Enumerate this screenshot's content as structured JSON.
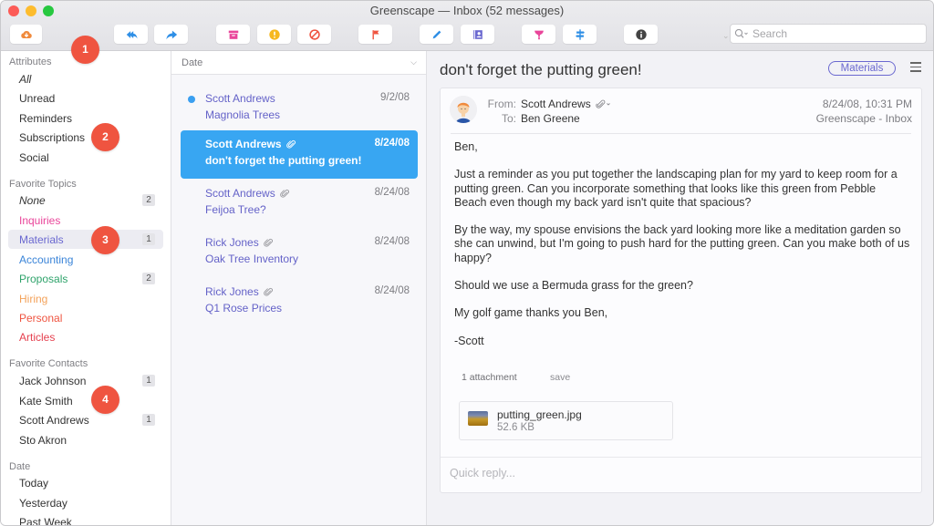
{
  "window": {
    "title": "Greenscape — Inbox (52 messages)"
  },
  "toolbar": {
    "buttons": [
      {
        "name": "get-mail",
        "icon": "cloud-download-icon",
        "color": "#f08a3c"
      },
      {
        "name": "reply-all",
        "icon": "reply-all-icon",
        "color": "#2f8fe6"
      },
      {
        "name": "forward",
        "icon": "forward-icon",
        "color": "#2f8fe6"
      },
      {
        "name": "archive",
        "icon": "archive-box-icon",
        "color": "#e9459a"
      },
      {
        "name": "important",
        "icon": "exclamation-icon",
        "color": "#f6b820"
      },
      {
        "name": "spam",
        "icon": "block-icon",
        "color": "#ef5440"
      },
      {
        "name": "flag",
        "icon": "flag-icon",
        "color": "#ef5440"
      },
      {
        "name": "compose",
        "icon": "pencil-icon",
        "color": "#2f8fe6"
      },
      {
        "name": "contacts",
        "icon": "address-book-icon",
        "color": "#6a68d0"
      },
      {
        "name": "filter",
        "icon": "funnel-icon",
        "color": "#e9459a"
      },
      {
        "name": "rules",
        "icon": "signpost-icon",
        "color": "#2f8fe6"
      },
      {
        "name": "info",
        "icon": "info-icon",
        "color": "#444444"
      }
    ],
    "search_placeholder": "Search"
  },
  "sidebar": {
    "attributes": {
      "heading": "Attributes",
      "items": [
        {
          "label": "All",
          "italic": true
        },
        {
          "label": "Unread"
        },
        {
          "label": "Reminders"
        },
        {
          "label": "Subscriptions"
        },
        {
          "label": "Social"
        }
      ]
    },
    "topics": {
      "heading": "Favorite Topics",
      "items": [
        {
          "label": "None",
          "italic": true,
          "count": "2",
          "color": "#333333"
        },
        {
          "label": "Inquiries",
          "color": "#e9459a"
        },
        {
          "label": "Materials",
          "count": "1",
          "color": "#6a68d0",
          "active": true
        },
        {
          "label": "Accounting",
          "color": "#3a84d8"
        },
        {
          "label": "Proposals",
          "count": "2",
          "color": "#2fa36b"
        },
        {
          "label": "Hiring",
          "color": "#f3a25a"
        },
        {
          "label": "Personal",
          "color": "#ef5440"
        },
        {
          "label": "Articles",
          "color": "#e5404f"
        }
      ]
    },
    "contacts": {
      "heading": "Favorite Contacts",
      "items": [
        {
          "label": "Jack Johnson",
          "count": "1"
        },
        {
          "label": "Kate Smith"
        },
        {
          "label": "Scott Andrews",
          "count": "1"
        },
        {
          "label": "Sto Akron"
        }
      ]
    },
    "date": {
      "heading": "Date",
      "items": [
        {
          "label": "Today"
        },
        {
          "label": "Yesterday"
        },
        {
          "label": "Past Week"
        }
      ]
    }
  },
  "message_list": {
    "sort_label": "Date",
    "messages": [
      {
        "from": "Scott Andrews",
        "subject": "Magnolia Trees",
        "date": "9/2/08",
        "unread": true,
        "attachment": false
      },
      {
        "from": "Scott Andrews",
        "subject": "don't forget the putting green!",
        "date": "8/24/08",
        "selected": true,
        "attachment": true
      },
      {
        "from": "Scott Andrews",
        "subject": "Feijoa Tree?",
        "date": "8/24/08",
        "attachment": true
      },
      {
        "from": "Rick Jones",
        "subject": "Oak Tree Inventory",
        "date": "8/24/08",
        "attachment": true
      },
      {
        "from": "Rick Jones",
        "subject": "Q1 Rose Prices",
        "date": "8/24/08",
        "attachment": true
      }
    ]
  },
  "reader": {
    "subject": "don't forget the putting green!",
    "tag": "Materials",
    "from_label": "From:",
    "from": "Scott Andrews",
    "to_label": "To:",
    "to": "Ben Greene",
    "datetime": "8/24/08, 10:31 PM",
    "mailbox": "Greenscape - Inbox",
    "body": [
      "Ben,",
      "Just a reminder as you put together the landscaping plan for my yard to keep room for a putting green. Can you incorporate something that looks like this green from Pebble Beach even though my back yard isn't quite that spacious?",
      "By the way, my spouse envisions the back yard looking more like a meditation garden so she can unwind, but I'm going to push hard for the putting green. Can you make both of us happy?",
      "Should we use a Bermuda grass for the green?",
      "My golf game thanks you Ben,",
      "-Scott"
    ],
    "attachments_label": "1 attachment",
    "save_label": "save",
    "attachment": {
      "name": "putting_green.jpg",
      "size": "52.6 KB"
    },
    "quick_reply_placeholder": "Quick reply..."
  },
  "callouts": [
    "1",
    "2",
    "3",
    "4"
  ]
}
